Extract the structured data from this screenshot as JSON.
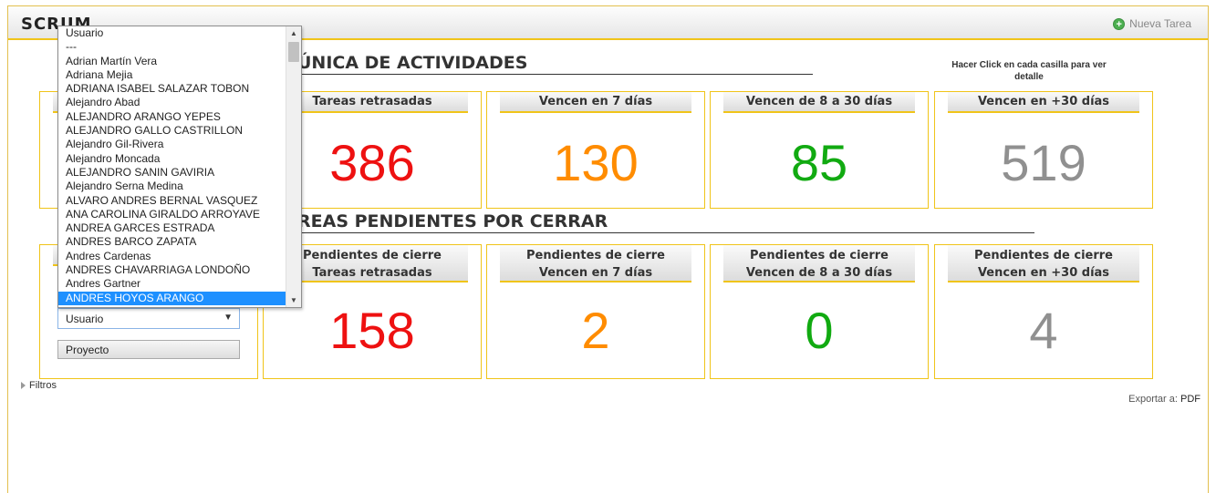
{
  "header": {
    "app_title": "SCRUM",
    "new_task_label": "Nueva Tarea"
  },
  "sections": {
    "activities_title": "ÚNICA DE ACTIVIDADES",
    "pending_title": "REAS PENDIENTES POR CERRAR"
  },
  "hint_text": "Hacer Click en cada casilla para ver detalle",
  "activity_cards": [
    {
      "label": "Tareas retrasadas",
      "value": "386",
      "color": "#ee1111"
    },
    {
      "label": "Vencen en 7 días",
      "value": "130",
      "color": "#ff8c00"
    },
    {
      "label": "Vencen de 8 a 30 días",
      "value": "85",
      "color": "#11aa11"
    },
    {
      "label": "Vencen en +30 días",
      "value": "519",
      "color": "#909090"
    }
  ],
  "pending_cards": [
    {
      "label1": "Pendientes de cierre",
      "label2": "Tareas retrasadas",
      "value": "158",
      "color": "#ee1111"
    },
    {
      "label1": "Pendientes de cierre",
      "label2": "Vencen en 7 días",
      "value": "2",
      "color": "#ff8c00"
    },
    {
      "label1": "Pendientes de cierre",
      "label2": "Vencen de 8 a 30 días",
      "value": "0",
      "color": "#11aa11"
    },
    {
      "label1": "Pendientes de cierre",
      "label2": "Vencen en +30 días",
      "value": "4",
      "color": "#909090"
    }
  ],
  "filters_panel": {
    "user_select_value": "Usuario",
    "project_button": "Proyecto"
  },
  "filters_label": "Filtros",
  "export": {
    "label": "Exportar a:",
    "pdf": "PDF"
  },
  "dropdown": {
    "items": [
      "Usuario",
      "---",
      "Adrian Martín Vera",
      "Adriana Mejia",
      "ADRIANA ISABEL SALAZAR TOBON",
      "Alejandro Abad",
      "ALEJANDRO ARANGO YEPES",
      "ALEJANDRO GALLO CASTRILLON",
      "Alejandro Gil-Rivera",
      "Alejandro Moncada",
      "ALEJANDRO SANIN GAVIRIA",
      "Alejandro Serna Medina",
      "ALVARO ANDRES BERNAL VASQUEZ",
      "ANA CAROLINA GIRALDO ARROYAVE",
      "ANDREA GARCES ESTRADA",
      "ANDRES BARCO ZAPATA",
      "Andres Cardenas",
      "ANDRES CHAVARRIAGA LONDOÑO",
      "Andres Gartner",
      "ANDRES HOYOS ARANGO"
    ],
    "selected_index": 19
  },
  "colors": {
    "accent_border": "#f0c419",
    "selection": "#1e90ff"
  }
}
